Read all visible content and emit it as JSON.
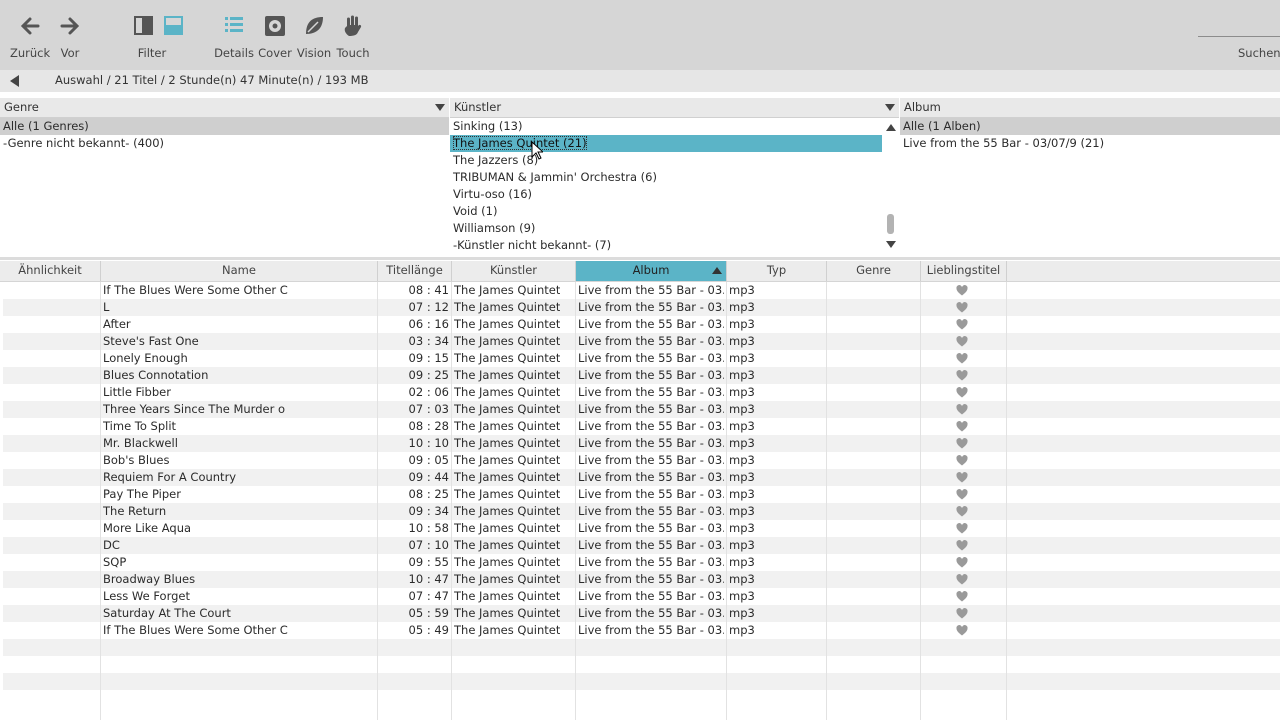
{
  "toolbar": {
    "back": "Zurück",
    "forward": "Vor",
    "filter": "Filter",
    "details": "Details",
    "cover": "Cover",
    "vision": "Vision",
    "touch": "Touch",
    "search": "Suchen"
  },
  "breadcrumb": "Auswahl  /  21 Titel  /  2 Stunde(n) 47 Minute(n)  /  193 MB",
  "panes": {
    "genre": {
      "title": "Genre",
      "items": [
        "Alle (1 Genres)",
        "-Genre nicht bekannt-  (400)"
      ]
    },
    "artist": {
      "title": "Künstler",
      "items": [
        "Sinking  (13)",
        "The James Quintet  (21)",
        "The Jazzers  (8)",
        "TRIBUMAN & Jammin' Orchestra  (6)",
        "Virtu-oso  (16)",
        "Void  (1)",
        "Williamson  (9)",
        "-Künstler nicht bekannt-  (7)"
      ]
    },
    "album": {
      "title": "Album",
      "items": [
        "Alle (1 Alben)",
        "Live from the 55 Bar - 03/07/9  (21)"
      ]
    }
  },
  "columns": [
    "Ähnlichkeit",
    "Name",
    "Titellänge",
    "Künstler",
    "Album",
    "Typ",
    "Genre",
    "Lieblingstitel"
  ],
  "colors": {
    "accent": "#5bb4c7",
    "toolbar": "#d6d6d6",
    "heart": "#9a9a9a"
  },
  "rows": [
    {
      "name": "If The Blues Were Some Other C",
      "len": "08 : 41",
      "artist": "The James Quintet",
      "album": "Live from the 55 Bar - 03...",
      "type": "mp3"
    },
    {
      "name": "L",
      "len": "07 : 12",
      "artist": "The James Quintet",
      "album": "Live from the 55 Bar - 03...",
      "type": "mp3"
    },
    {
      "name": "After",
      "len": "06 : 16",
      "artist": "The James Quintet",
      "album": "Live from the 55 Bar - 03...",
      "type": "mp3"
    },
    {
      "name": "Steve's Fast One",
      "len": "03 : 34",
      "artist": "The James Quintet",
      "album": "Live from the 55 Bar - 03...",
      "type": "mp3"
    },
    {
      "name": "Lonely Enough",
      "len": "09 : 15",
      "artist": "The James Quintet",
      "album": "Live from the 55 Bar - 03...",
      "type": "mp3"
    },
    {
      "name": "Blues Connotation",
      "len": "09 : 25",
      "artist": "The James Quintet",
      "album": "Live from the 55 Bar - 03...",
      "type": "mp3"
    },
    {
      "name": "Little Fibber",
      "len": "02 : 06",
      "artist": "The James Quintet",
      "album": "Live from the 55 Bar - 03...",
      "type": "mp3"
    },
    {
      "name": "Three Years Since The Murder o",
      "len": "07 : 03",
      "artist": "The James Quintet",
      "album": "Live from the 55 Bar - 03...",
      "type": "mp3"
    },
    {
      "name": "Time To Split",
      "len": "08 : 28",
      "artist": "The James Quintet",
      "album": "Live from the 55 Bar - 03...",
      "type": "mp3"
    },
    {
      "name": "Mr. Blackwell",
      "len": "10 : 10",
      "artist": "The James Quintet",
      "album": "Live from the 55 Bar - 03...",
      "type": "mp3"
    },
    {
      "name": "Bob's Blues",
      "len": "09 : 05",
      "artist": "The James Quintet",
      "album": "Live from the 55 Bar - 03...",
      "type": "mp3"
    },
    {
      "name": "Requiem For A Country",
      "len": "09 : 44",
      "artist": "The James Quintet",
      "album": "Live from the 55 Bar - 03...",
      "type": "mp3"
    },
    {
      "name": "Pay The Piper",
      "len": "08 : 25",
      "artist": "The James Quintet",
      "album": "Live from the 55 Bar - 03...",
      "type": "mp3"
    },
    {
      "name": "The Return",
      "len": "09 : 34",
      "artist": "The James Quintet",
      "album": "Live from the 55 Bar - 03...",
      "type": "mp3"
    },
    {
      "name": "More Like Aqua",
      "len": "10 : 58",
      "artist": "The James Quintet",
      "album": "Live from the 55 Bar - 03...",
      "type": "mp3"
    },
    {
      "name": "DC",
      "len": "07 : 10",
      "artist": "The James Quintet",
      "album": "Live from the 55 Bar - 03...",
      "type": "mp3"
    },
    {
      "name": "SQP",
      "len": "09 : 55",
      "artist": "The James Quintet",
      "album": "Live from the 55 Bar - 03...",
      "type": "mp3"
    },
    {
      "name": "Broadway Blues",
      "len": "10 : 47",
      "artist": "The James Quintet",
      "album": "Live from the 55 Bar - 03...",
      "type": "mp3"
    },
    {
      "name": "Less We Forget",
      "len": "07 : 47",
      "artist": "The James Quintet",
      "album": "Live from the 55 Bar - 03...",
      "type": "mp3"
    },
    {
      "name": "Saturday At The Court",
      "len": "05 : 59",
      "artist": "The James Quintet",
      "album": "Live from the 55 Bar - 03...",
      "type": "mp3"
    },
    {
      "name": "If The Blues Were Some Other C",
      "len": "05 : 49",
      "artist": "The James Quintet",
      "album": "Live from the 55 Bar - 03...",
      "type": "mp3"
    }
  ]
}
